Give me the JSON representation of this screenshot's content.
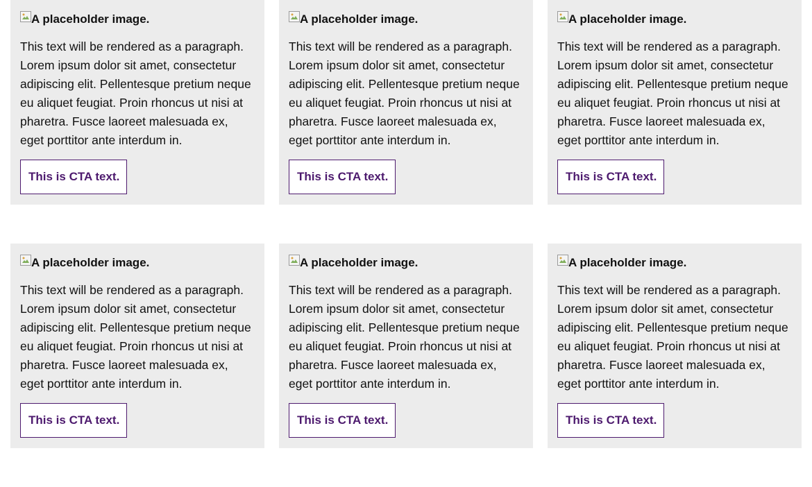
{
  "colors": {
    "card_background": "#ececec",
    "cta_accent": "#4d1a6e",
    "page_background": "#ffffff"
  },
  "cards": [
    {
      "image_alt": "A placeholder image.",
      "image_icon": "broken-image-icon",
      "paragraph": "This text will be rendered as a paragraph. Lorem ipsum dolor sit amet, consectetur adipiscing elit. Pellentesque pretium neque eu aliquet feugiat. Proin rhoncus ut nisi at pharetra. Fusce laoreet malesuada ex, eget porttitor ante interdum in.",
      "cta": "This is CTA text."
    },
    {
      "image_alt": "A placeholder image.",
      "image_icon": "broken-image-icon",
      "paragraph": "This text will be rendered as a paragraph. Lorem ipsum dolor sit amet, consectetur adipiscing elit. Pellentesque pretium neque eu aliquet feugiat. Proin rhoncus ut nisi at pharetra. Fusce laoreet malesuada ex, eget porttitor ante interdum in.",
      "cta": "This is CTA text."
    },
    {
      "image_alt": "A placeholder image.",
      "image_icon": "broken-image-icon",
      "paragraph": "This text will be rendered as a paragraph. Lorem ipsum dolor sit amet, consectetur adipiscing elit. Pellentesque pretium neque eu aliquet feugiat. Proin rhoncus ut nisi at pharetra. Fusce laoreet malesuada ex, eget porttitor ante interdum in.",
      "cta": "This is CTA text."
    },
    {
      "image_alt": "A placeholder image.",
      "image_icon": "broken-image-icon",
      "paragraph": "This text will be rendered as a paragraph. Lorem ipsum dolor sit amet, consectetur adipiscing elit. Pellentesque pretium neque eu aliquet feugiat. Proin rhoncus ut nisi at pharetra. Fusce laoreet malesuada ex, eget porttitor ante interdum in.",
      "cta": "This is CTA text."
    },
    {
      "image_alt": "A placeholder image.",
      "image_icon": "broken-image-icon",
      "paragraph": "This text will be rendered as a paragraph. Lorem ipsum dolor sit amet, consectetur adipiscing elit. Pellentesque pretium neque eu aliquet feugiat. Proin rhoncus ut nisi at pharetra. Fusce laoreet malesuada ex, eget porttitor ante interdum in.",
      "cta": "This is CTA text."
    },
    {
      "image_alt": "A placeholder image.",
      "image_icon": "broken-image-icon",
      "paragraph": "This text will be rendered as a paragraph. Lorem ipsum dolor sit amet, consectetur adipiscing elit. Pellentesque pretium neque eu aliquet feugiat. Proin rhoncus ut nisi at pharetra. Fusce laoreet malesuada ex, eget porttitor ante interdum in.",
      "cta": "This is CTA text."
    }
  ]
}
